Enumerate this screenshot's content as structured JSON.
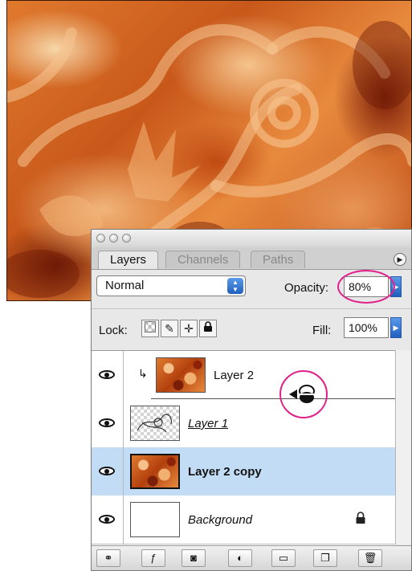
{
  "panel": {
    "tabs": [
      {
        "label": "Layers",
        "active": true
      },
      {
        "label": "Channels",
        "active": false
      },
      {
        "label": "Paths",
        "active": false
      }
    ],
    "menu_icon": "triangle-right-icon",
    "blend_mode": "Normal",
    "opacity_label": "Opacity:",
    "opacity_value": "80%",
    "lock_label": "Lock:",
    "lock_icons": [
      "lock-transparent-icon",
      "lock-paint-icon",
      "lock-move-icon",
      "lock-all-icon"
    ],
    "fill_label": "Fill:",
    "fill_value": "100%",
    "layers": [
      {
        "name": "Layer 2",
        "thumbnail": "orange",
        "visible": true,
        "clipped": true,
        "selected": false
      },
      {
        "name": "Layer 1",
        "thumbnail": "checker",
        "visible": true,
        "clipped": false,
        "selected": false
      },
      {
        "name": "Layer 2 copy",
        "thumbnail": "orange",
        "visible": true,
        "clipped": false,
        "selected": true
      },
      {
        "name": "Background",
        "thumbnail": "white",
        "visible": true,
        "clipped": false,
        "selected": false,
        "locked": true
      }
    ],
    "bottom_icons": [
      "link-icon",
      "layer-style-icon",
      "layer-mask-icon",
      "adjustment-layer-icon",
      "folder-icon",
      "new-layer-icon",
      "trash-icon"
    ],
    "clip_cursor_icon": "clipping-mask-cursor-icon"
  },
  "colors": {
    "selection": "#c3dcf5",
    "highlight": "#e0208a",
    "accent_blue": "#1f5fbf"
  }
}
